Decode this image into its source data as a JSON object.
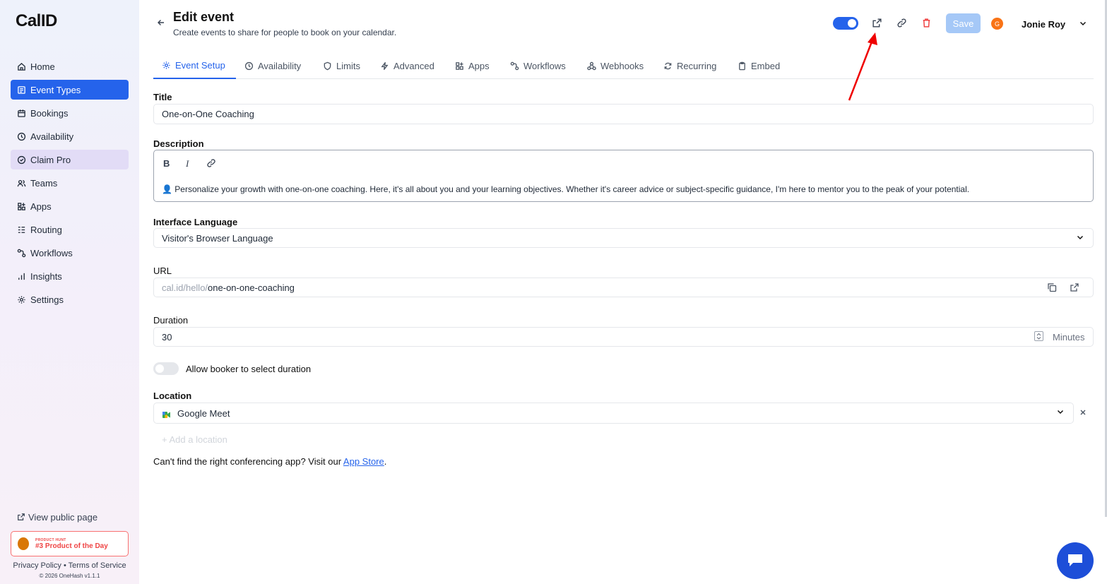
{
  "sidebar": {
    "logo": "CalID",
    "items": [
      {
        "label": "Home",
        "icon": "home-icon"
      },
      {
        "label": "Event Types",
        "icon": "event-types-icon"
      },
      {
        "label": "Bookings",
        "icon": "calendar-icon"
      },
      {
        "label": "Availability",
        "icon": "clock-icon"
      },
      {
        "label": "Claim Pro",
        "icon": "badge-icon"
      },
      {
        "label": "Teams",
        "icon": "users-icon"
      },
      {
        "label": "Apps",
        "icon": "grid-icon"
      },
      {
        "label": "Routing",
        "icon": "routing-icon"
      },
      {
        "label": "Workflows",
        "icon": "workflow-icon"
      },
      {
        "label": "Insights",
        "icon": "bar-chart-icon"
      },
      {
        "label": "Settings",
        "icon": "gear-icon"
      }
    ],
    "view_public": "View public page",
    "ph_small": "PRODUCT HUNT",
    "ph_big": "#3 Product of the Day",
    "privacy": "Privacy Policy",
    "sep": "•",
    "terms": "Terms of Service",
    "copyright": "© 2026 OneHash v1.1.1"
  },
  "header": {
    "title": "Edit event",
    "subtitle": "Create events to share for people to book on your calendar.",
    "save_label": "Save",
    "avatar_initial": "G",
    "user_name": "Jonie Roy"
  },
  "tabs": [
    "Event Setup",
    "Availability",
    "Limits",
    "Advanced",
    "Apps",
    "Workflows",
    "Webhooks",
    "Recurring",
    "Embed"
  ],
  "form": {
    "title_label": "Title",
    "title_value": "One-on-One Coaching",
    "description_label": "Description",
    "description_value": "👤 Personalize your growth with one-on-one coaching. Here, it's all about you and your learning objectives. Whether it's career advice or subject-specific guidance, I'm here to mentor you to the peak of your potential.",
    "language_label": "Interface Language",
    "language_value": "Visitor's Browser Language",
    "url_label": "URL",
    "url_prefix": "cal.id/hello/",
    "url_slug": "one-on-one-coaching",
    "duration_label": "Duration",
    "duration_value": "30",
    "duration_unit": "Minutes",
    "allow_duration_label": "Allow booker to select duration",
    "location_label": "Location",
    "location_value": "Google Meet",
    "add_location": "+ Add a location",
    "cant_find_prefix": "Can't find the right conferencing app? Visit our ",
    "app_store_link": "App Store",
    "cant_find_suffix": "."
  },
  "colors": {
    "primary": "#2563eb",
    "danger": "#ef4444",
    "annotation_arrow": "#ef0000"
  }
}
